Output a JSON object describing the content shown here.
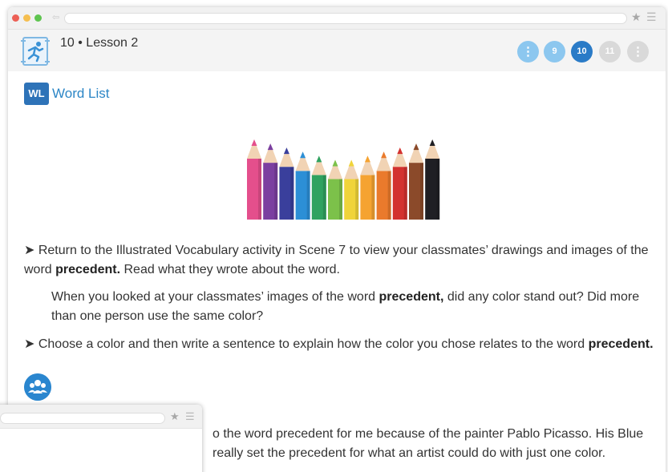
{
  "window": {
    "icons": {
      "back": "back-arrow-icon",
      "bookmark": "star-icon",
      "menu": "hamburger-menu-icon"
    }
  },
  "header": {
    "lesson_title": "10 • Lesson 2",
    "nav": {
      "prev_more": "⋮",
      "pages": [
        "9",
        "10",
        "11"
      ],
      "current_page": "10",
      "next_more": "⋮"
    },
    "colors": {
      "nav_inactive": "#8cc7ef",
      "nav_active": "#2a7bc7",
      "nav_disabled": "#d9d9d9"
    }
  },
  "word_list": {
    "badge": "WL",
    "link_label": "Word List",
    "color": "#2c86c6"
  },
  "pencil_image": {
    "pencil_colors": [
      "#e44f8c",
      "#7b3fa0",
      "#3a3f9c",
      "#2c8fd6",
      "#2fa260",
      "#7cc14a",
      "#f0d43a",
      "#f5a331",
      "#ea7a2c",
      "#d3322f",
      "#8b4a2a",
      "#1f1f24"
    ]
  },
  "content": {
    "p1": {
      "arrow": "➤",
      "text_a": " Return to the Illustrated Vocabulary activity in Scene 7 to view your classmates’ drawings and images of the word ",
      "bold": "precedent.",
      "text_b": " Read what they wrote about the word."
    },
    "p2": {
      "text_a": "When you looked at your classmates’ images of the word ",
      "bold": "precedent,",
      "text_b": " did any color stand out? Did more than one person use the same color?"
    },
    "p3": {
      "arrow": "➤",
      "text_a": " Choose a color and then write a sentence to explain how the color you chose relates to the word ",
      "bold": "precedent."
    },
    "response": {
      "line1": "o the word precedent for me because of the painter Pablo Picasso. His Blue",
      "line2": "really set the precedent for what an artist could do with just one color."
    }
  }
}
